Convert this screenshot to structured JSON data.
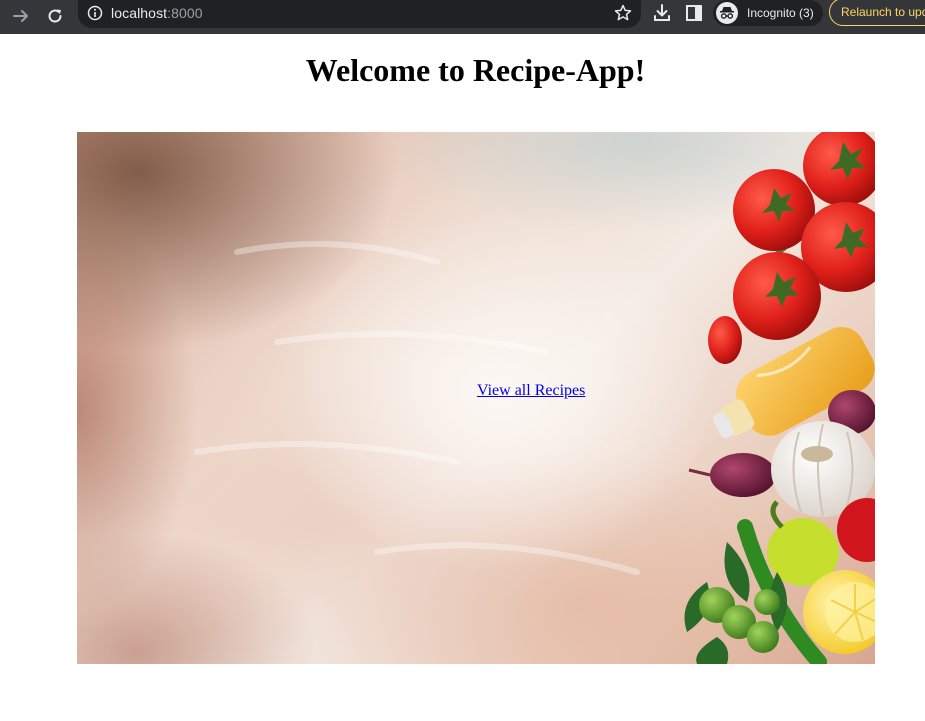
{
  "browser": {
    "url_host": "localhost",
    "url_port": ":8000",
    "incognito_label": "Incognito (3)",
    "relaunch_label": "Relaunch to update",
    "icons": [
      "forward-icon",
      "reload-icon",
      "info-icon",
      "star-icon",
      "download-icon",
      "side-panel-icon",
      "incognito-icon"
    ]
  },
  "page": {
    "title": "Welcome to Recipe-App!",
    "link_text": "View all Recipes"
  },
  "colors": {
    "chrome_bg": "#35363a",
    "omnibox_bg": "#202124",
    "relaunch_accent": "#fdd663",
    "link": "#0000ee"
  }
}
